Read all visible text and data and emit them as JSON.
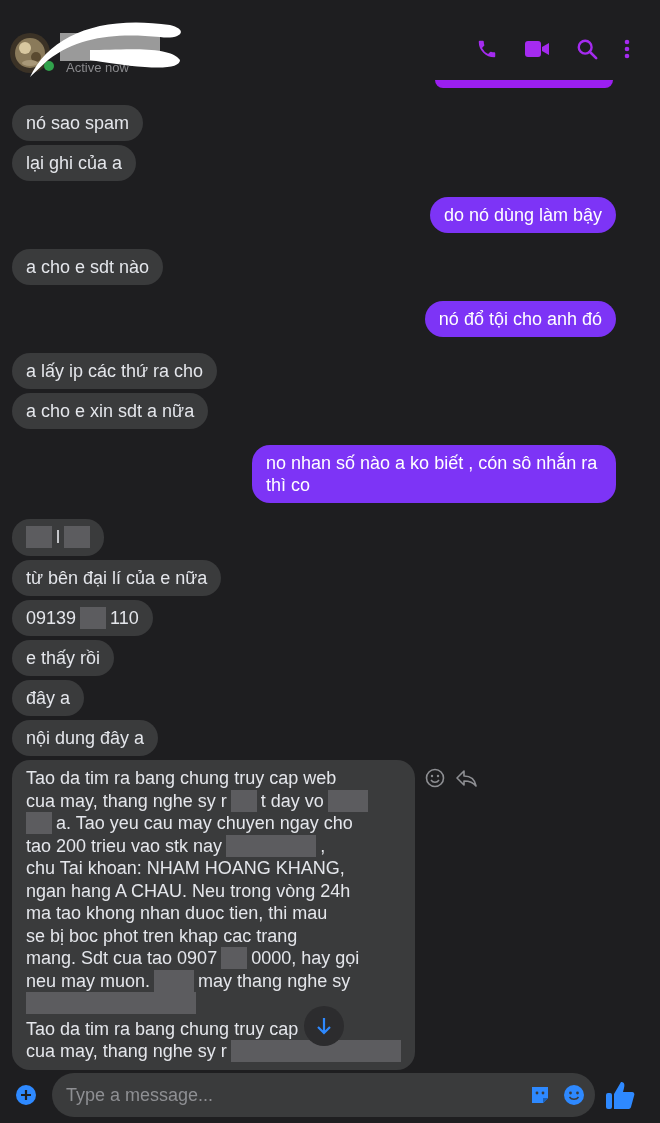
{
  "header": {
    "status": "Active now",
    "online": true
  },
  "messages": [
    {
      "outgoing": false,
      "text": "nó sao spam"
    },
    {
      "outgoing": false,
      "text": "lại ghi của a"
    },
    {
      "outgoing": true,
      "text": "do nó dùng làm bậy"
    },
    {
      "outgoing": false,
      "text": "a cho e sdt nào"
    },
    {
      "outgoing": true,
      "text": "nó đổ tội cho anh đó"
    },
    {
      "outgoing": false,
      "text": "a lấy ip các thứ ra cho"
    },
    {
      "outgoing": false,
      "text": "a cho e xin sdt a nữa"
    },
    {
      "outgoing": true,
      "text": "no nhan số nào a ko biết , cón sô nhắn ra thì co"
    },
    {
      "outgoing": false,
      "lines": [
        {
          "parts": [
            {
              "kind": "redacted"
            },
            {
              "kind": "text",
              "text": "l"
            },
            {
              "kind": "redacted"
            }
          ]
        }
      ]
    },
    {
      "outgoing": false,
      "text": "từ bên đại lí của e nữa"
    },
    {
      "outgoing": false,
      "lines": [
        {
          "parts": [
            {
              "kind": "text",
              "text": "09139"
            },
            {
              "kind": "redacted"
            },
            {
              "kind": "text",
              "text": "110"
            }
          ]
        }
      ]
    },
    {
      "outgoing": false,
      "text": "e thấy rồi"
    },
    {
      "outgoing": false,
      "text": "đây a"
    },
    {
      "outgoing": false,
      "text": "nội dung đây a"
    },
    {
      "outgoing": false,
      "actions": true,
      "lines": [
        {
          "parts": [
            {
              "kind": "text",
              "text": "Tao da tim ra bang chung truy cap web"
            }
          ]
        },
        {
          "parts": [
            {
              "kind": "text",
              "text": "cua may, thang nghe sy r"
            },
            {
              "kind": "redacted"
            },
            {
              "kind": "text",
              "text": "t day vo"
            },
            {
              "kind": "redactedwide"
            }
          ]
        },
        {
          "parts": [
            {
              "kind": "redacted"
            },
            {
              "kind": "text",
              "text": "a. Tao yeu cau may chuyen ngay cho"
            }
          ]
        },
        {
          "parts": [
            {
              "kind": "text",
              "text": "tao 200 trieu vao stk nay"
            },
            {
              "kind": "redactedlong"
            },
            {
              "kind": "text",
              "text": ","
            }
          ]
        },
        {
          "parts": [
            {
              "kind": "text",
              "text": "chu Tai khoan: NHAM HOANG KHANG,"
            }
          ]
        },
        {
          "parts": [
            {
              "kind": "text",
              "text": "ngan hang A CHAU. Neu trong vòng 24h"
            }
          ]
        },
        {
          "parts": [
            {
              "kind": "text",
              "text": "ma tao khong nhan duoc tien, thi mau"
            }
          ]
        },
        {
          "parts": [
            {
              "kind": "text",
              "text": "se bị boc phot tren khap cac trang"
            }
          ]
        },
        {
          "parts": [
            {
              "kind": "text",
              "text": "mang. Sdt cua tao 0907"
            },
            {
              "kind": "redacted"
            },
            {
              "kind": "text",
              "text": "0000, hay gọi"
            }
          ]
        },
        {
          "parts": [
            {
              "kind": "text",
              "text": "neu may muon."
            },
            {
              "kind": "redactedwide"
            },
            {
              "kind": "text",
              "text": "may thang nghe sy"
            }
          ]
        },
        {
          "paragraph_end": true,
          "parts": [
            {
              "kind": "redactedbar"
            }
          ]
        },
        {
          "parts": [
            {
              "kind": "text",
              "text": "Tao da tim ra bang chung truy cap"
            },
            {
              "kind": "scroll-button"
            }
          ]
        },
        {
          "parts": [
            {
              "kind": "text",
              "text": "cua may, thang nghe sy r"
            },
            {
              "kind": "redactedbar"
            }
          ]
        }
      ]
    }
  ],
  "composer": {
    "placeholder": "Type a message..."
  }
}
